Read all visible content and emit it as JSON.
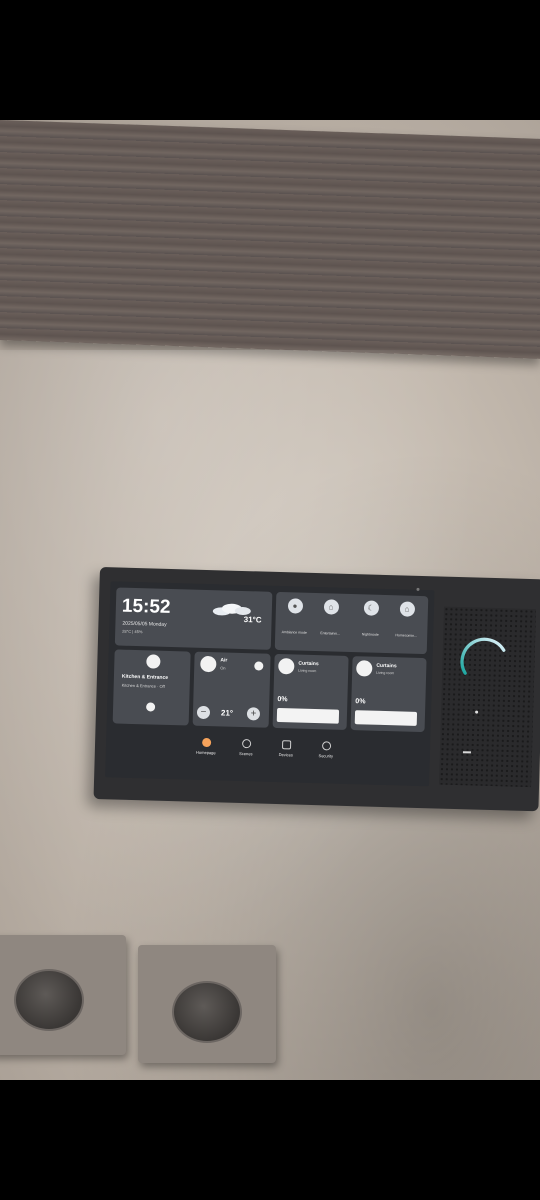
{
  "device_ui": {
    "clock": {
      "time": "15:52",
      "date": "2025/05/05 Monday",
      "weather_detail": "28°C | 45%",
      "temperature": "31°C"
    },
    "modes": [
      {
        "label": "Ambiance mode",
        "icon": "circle-icon"
      },
      {
        "label": "Entertainm...",
        "icon": "home-icon"
      },
      {
        "label": "Nightmode",
        "icon": "moon-icon"
      },
      {
        "label": "Homecomin...",
        "icon": "home-icon"
      }
    ],
    "room": {
      "title": "Kitchen & Entrance",
      "subtitle": "Kitchen & Entrance · Off"
    },
    "air": {
      "name": "Air",
      "subtitle": "On",
      "minus": "−",
      "setpoint": "21°",
      "plus": "+"
    },
    "curtains": [
      {
        "name": "Curtains",
        "location": "Living room",
        "percent": "0%",
        "level": 0
      },
      {
        "name": "Curtains",
        "location": "Living room",
        "percent": "0%",
        "level": 0
      }
    ],
    "nav": [
      {
        "label": "Homepage",
        "active": true
      },
      {
        "label": "Scenes",
        "active": false
      },
      {
        "label": "Devices",
        "active": false
      },
      {
        "label": "Security",
        "active": false
      }
    ]
  },
  "colors": {
    "screen_bg": "#2a2c30",
    "card_bg": "#494c52",
    "knob_ring_start": "#1aa6a0",
    "knob_ring_end": "#e8f6ff",
    "active_nav": "#f6a35b"
  }
}
